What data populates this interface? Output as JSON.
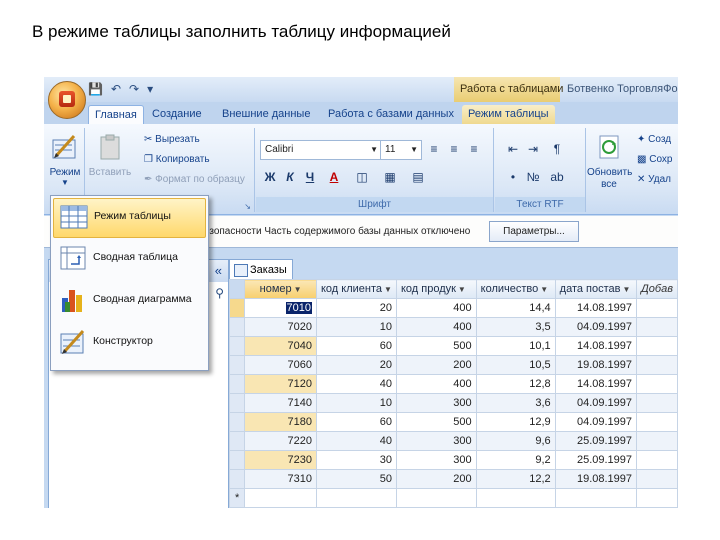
{
  "slide": {
    "title": "В режиме таблицы  заполнить таблицу информацией"
  },
  "titlebar": {
    "context_tab_group": "Работа с таблицами",
    "app_title": "Ботвенко ТорговляФор",
    "qat": [
      "save-icon",
      "undo-icon",
      "redo-icon",
      "customize-icon"
    ]
  },
  "tabs": [
    "Главная",
    "Создание",
    "Внешние данные",
    "Работа с базами данных",
    "Режим таблицы"
  ],
  "ribbon": {
    "views_label": "Режим",
    "paste_label": "Вставить",
    "cut_label": "Вырезать",
    "copy_label": "Копировать",
    "format_painter_label": "Формат по образцу",
    "font_name": "Calibri",
    "font_size": "11",
    "font_group_label": "Шрифт",
    "rtf_group_label": "Текст RTF",
    "refresh_label": "Обновить все",
    "create_label": "Созд",
    "save_label": "Сохр",
    "delete_label": "Удал",
    "bold": "Ж",
    "italic": "К",
    "underline": "Ч",
    "font_color": "A"
  },
  "view_menu": {
    "items": [
      {
        "label": "Режим таблицы",
        "icon": "datasheet-icon",
        "highlighted": true
      },
      {
        "label": "Сводная таблица",
        "icon": "pivot-table-icon",
        "highlighted": false
      },
      {
        "label": "Сводная диаграмма",
        "icon": "pivot-chart-icon",
        "highlighted": false
      },
      {
        "label": "Конструктор",
        "icon": "design-view-icon",
        "highlighted": false
      }
    ]
  },
  "message_bar": {
    "text": "езопасности  Часть содержимого базы данных отключено",
    "button": "Параметры..."
  },
  "nav": {
    "collapse": "«",
    "search_icon": "search-icon"
  },
  "table": {
    "tab_label": "Заказы",
    "columns": [
      "номер",
      "код клиента",
      "код продук",
      "количество",
      "дата постав",
      "Добав"
    ],
    "rows": [
      [
        "7010",
        "20",
        "400",
        "14,4",
        "14.08.1997"
      ],
      [
        "7020",
        "10",
        "400",
        "3,5",
        "04.09.1997"
      ],
      [
        "7040",
        "60",
        "500",
        "10,1",
        "14.08.1997"
      ],
      [
        "7060",
        "20",
        "200",
        "10,5",
        "19.08.1997"
      ],
      [
        "7120",
        "40",
        "400",
        "12,8",
        "14.08.1997"
      ],
      [
        "7140",
        "10",
        "300",
        "3,6",
        "04.09.1997"
      ],
      [
        "7180",
        "60",
        "500",
        "12,9",
        "04.09.1997"
      ],
      [
        "7220",
        "40",
        "300",
        "9,6",
        "25.09.1997"
      ],
      [
        "7230",
        "30",
        "300",
        "9,2",
        "25.09.1997"
      ],
      [
        "7310",
        "50",
        "200",
        "12,2",
        "19.08.1997"
      ]
    ],
    "new_row_marker": "*"
  }
}
